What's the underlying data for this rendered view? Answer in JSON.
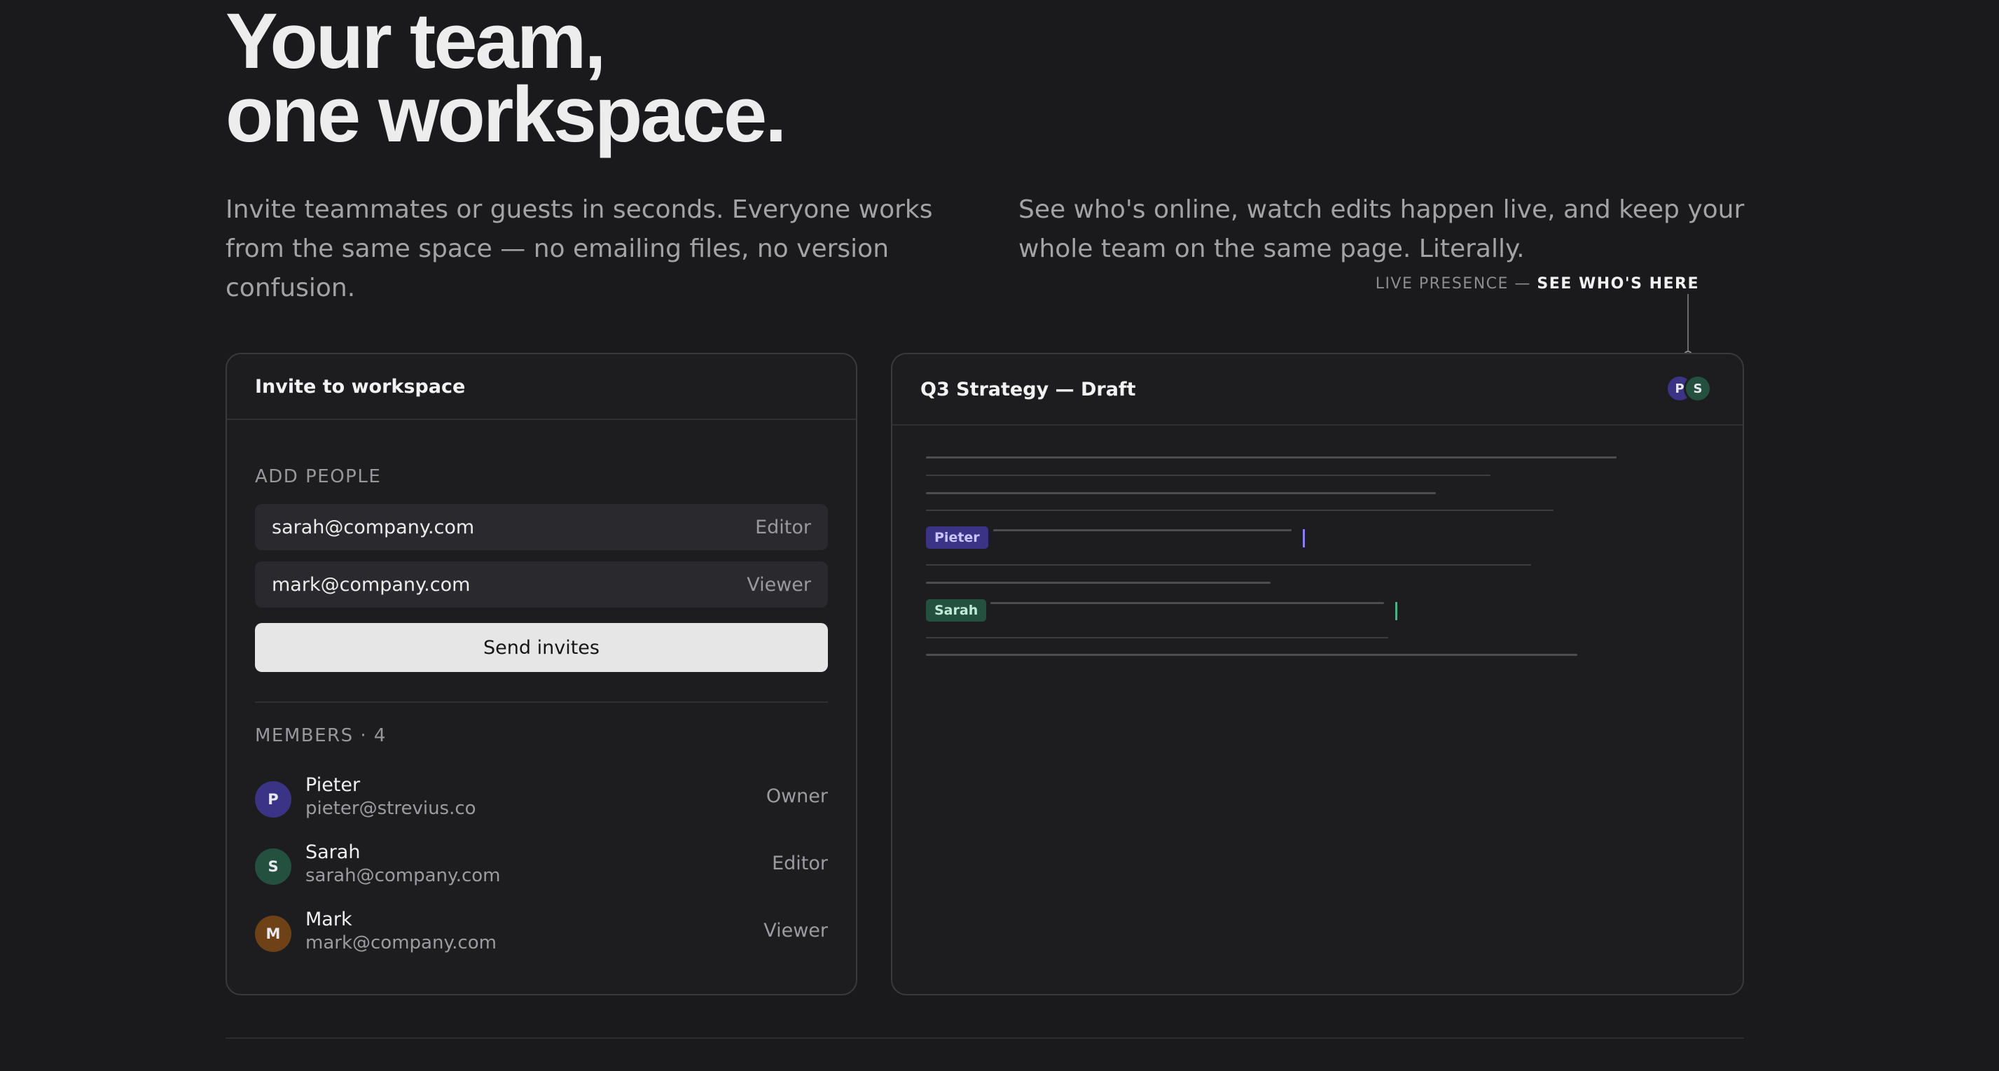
{
  "hero": {
    "title_line1": "Your team,",
    "title_line2": "one workspace.",
    "intro_left": "Invite teammates or guests in seconds. Everyone works from the same space — no emailing files, no version confusion.",
    "intro_right": "See who's online, watch edits happen live, and keep your whole team on the same page. Literally."
  },
  "callout": {
    "prefix": "LIVE PRESENCE — ",
    "emphasis": "SEE WHO'S HERE"
  },
  "invite_card": {
    "title": "Invite to workspace",
    "add_people_label": "ADD PEOPLE",
    "invites": [
      {
        "email": "sarah@company.com",
        "role": "Editor"
      },
      {
        "email": "mark@company.com",
        "role": "Viewer"
      }
    ],
    "send_button": "Send invites",
    "members_label": "MEMBERS · 4",
    "members": [
      {
        "initial": "P",
        "name": "Pieter",
        "email": "pieter@strevius.co",
        "role": "Owner",
        "color": "#3b3486"
      },
      {
        "initial": "S",
        "name": "Sarah",
        "email": "sarah@company.com",
        "role": "Editor",
        "color": "#24503f"
      },
      {
        "initial": "M",
        "name": "Mark",
        "email": "mark@company.com",
        "role": "Viewer",
        "color": "#6e4216"
      }
    ]
  },
  "doc_card": {
    "title": "Q3 Strategy — Draft",
    "presence": [
      {
        "initial": "P",
        "color": "#3b3486"
      },
      {
        "initial": "S",
        "color": "#24503f"
      }
    ],
    "cursors": [
      {
        "name": "Pieter",
        "bg": "#3b3486",
        "fg": "#c9c3ff",
        "caret": "#8a7ff0"
      },
      {
        "name": "Sarah",
        "bg": "#24503f",
        "fg": "#c2ead8",
        "caret": "#4fae87"
      }
    ]
  }
}
